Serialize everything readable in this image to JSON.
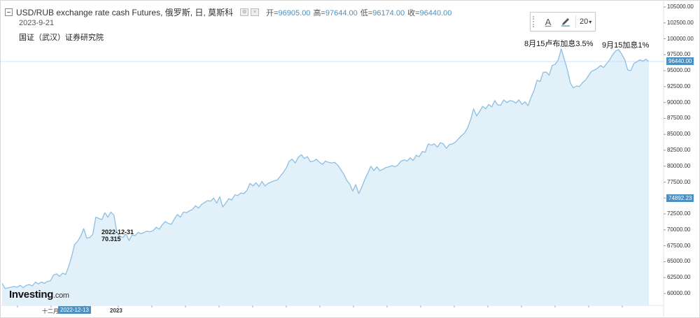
{
  "header": {
    "title": "USD/RUB exchange rate cash Futures, 俄罗斯, 日, 莫斯科",
    "ohlc": [
      {
        "label": "开=",
        "value": "96905.00"
      },
      {
        "label": "高=",
        "value": "97644.00"
      },
      {
        "label": "低=",
        "value": "96174.00"
      },
      {
        "label": "收=",
        "value": "96440.00"
      }
    ],
    "date": "2023-9-21",
    "source": "国证（武汉）证券研究院"
  },
  "toolbar": {
    "text_tool": "A",
    "font_size": "20"
  },
  "logo": {
    "main": "Investing",
    "suffix": ".com"
  },
  "chart_data": {
    "type": "area",
    "x_axis": {
      "ticks": [
        "十二月",
        "2023"
      ],
      "highlighted": "2022-12-13"
    },
    "y_axis": {
      "ylim": [
        59000,
        105000
      ],
      "ticks": [
        60000,
        62500,
        65000,
        67500,
        70000,
        72500,
        75000,
        77500,
        80000,
        82500,
        85000,
        87500,
        90000,
        92500,
        95000,
        97500,
        100000,
        102500,
        105000
      ],
      "tick_labels": [
        "60000.00",
        "62500.00",
        "65000.00",
        "67500.00",
        "70000.00",
        "72500.00",
        "75000.00",
        "77500.00",
        "80000.00",
        "82500.00",
        "85000.00",
        "87500.00",
        "90000.00",
        "92500.00",
        "95000.00",
        "97500.00",
        "100000.00",
        "102500.00",
        "105000.00"
      ],
      "position": "right"
    },
    "price_tags": [
      {
        "label": "96440.00",
        "value": 96440
      },
      {
        "label": "74892.23",
        "value": 74892.23
      }
    ],
    "crosshair": {
      "date": "2022-12-31",
      "value": "70.315"
    },
    "annotations": [
      {
        "text": "8月15卢布加息3.5%"
      },
      {
        "text": "9月15加息1%"
      }
    ],
    "series": [
      {
        "values": [
          61600,
          60800,
          60900,
          61000,
          61100,
          61000,
          61300,
          60900,
          61300,
          61400,
          61200,
          61800,
          61500,
          61800,
          61600,
          61900,
          62000,
          62900,
          63100,
          62700,
          63200,
          63000,
          64200,
          65800,
          67700,
          68200,
          69000,
          70200,
          68700,
          68800,
          69300,
          72000,
          71800,
          71600,
          72700,
          72000,
          72800,
          72300,
          69500,
          69000,
          68800,
          69400,
          68300,
          69200,
          69100,
          69600,
          69400,
          69600,
          69800,
          69700,
          69900,
          70400,
          70100,
          70800,
          71300,
          71000,
          70900,
          71700,
          72400,
          72000,
          72800,
          72700,
          73000,
          73200,
          73800,
          73400,
          74000,
          74300,
          74600,
          74500,
          75000,
          74200,
          75200,
          73600,
          74200,
          74900,
          74700,
          75500,
          75400,
          75800,
          75700,
          76200,
          77300,
          76900,
          77400,
          76800,
          77600,
          76900,
          77300,
          77500,
          77700,
          77800,
          78400,
          79000,
          79700,
          80800,
          81100,
          80500,
          81400,
          81800,
          81200,
          81500,
          80700,
          80800,
          81100,
          80600,
          80300,
          80800,
          80600,
          80500,
          80600,
          80200,
          79500,
          78800,
          77800,
          77200,
          76100,
          77100,
          75700,
          76700,
          77900,
          78900,
          80000,
          79300,
          79900,
          79300,
          79500,
          79800,
          79900,
          80100,
          79900,
          80200,
          80800,
          81000,
          80800,
          81300,
          80900,
          81700,
          81500,
          82300,
          82200,
          83500,
          83300,
          83500,
          83000,
          83700,
          83500,
          82800,
          83400,
          83500,
          83800,
          84300,
          84800,
          85200,
          86000,
          87300,
          89000,
          87900,
          88600,
          89400,
          89000,
          89700,
          89300,
          90300,
          89600,
          89600,
          90400,
          90000,
          90300,
          90200,
          89900,
          90400,
          89700,
          90100,
          89500,
          90800,
          91900,
          93500,
          93300,
          94700,
          94800,
          94300,
          95800,
          96000,
          96700,
          98400,
          96800,
          95200,
          93100,
          92300,
          92600,
          92500,
          93100,
          93500,
          94200,
          94900,
          95100,
          95400,
          95800,
          95500,
          96100,
          96700,
          97500,
          98100,
          98300,
          97600,
          96700,
          95100,
          95000,
          96100,
          96400,
          96700,
          96500,
          96800,
          96440
        ]
      }
    ]
  }
}
